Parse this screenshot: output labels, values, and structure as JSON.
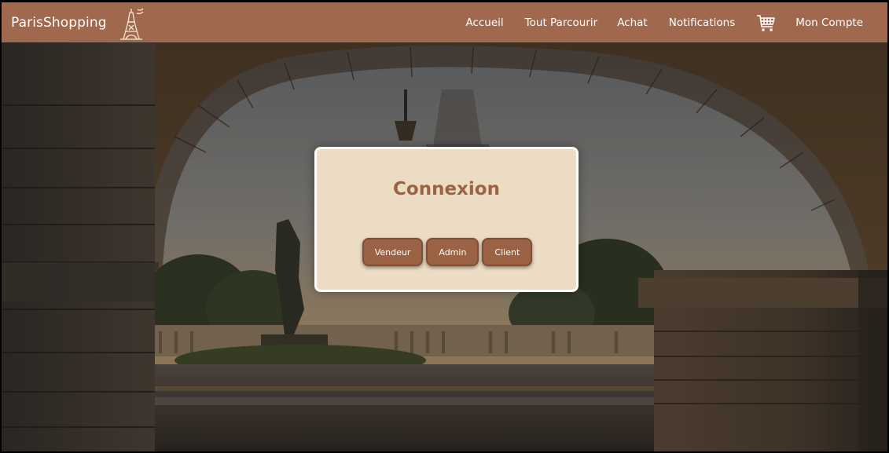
{
  "navbar": {
    "brand": "ParisShopping",
    "logo_icon": "eiffel-tower-icon",
    "links": [
      {
        "label": "Accueil"
      },
      {
        "label": "Tout Parcourir"
      },
      {
        "label": "Achat"
      },
      {
        "label": "Notifications"
      }
    ],
    "cart_icon": "shopping-cart-icon",
    "account_label": "Mon Compte"
  },
  "modal": {
    "title": "Connexion",
    "buttons": [
      {
        "label": "Vendeur"
      },
      {
        "label": "Admin"
      },
      {
        "label": "Client"
      }
    ]
  },
  "colors": {
    "navbar": "#a0684c",
    "modal_bg": "#ecdcc4",
    "accent": "#9b6344",
    "button_text": "#ffffff"
  }
}
